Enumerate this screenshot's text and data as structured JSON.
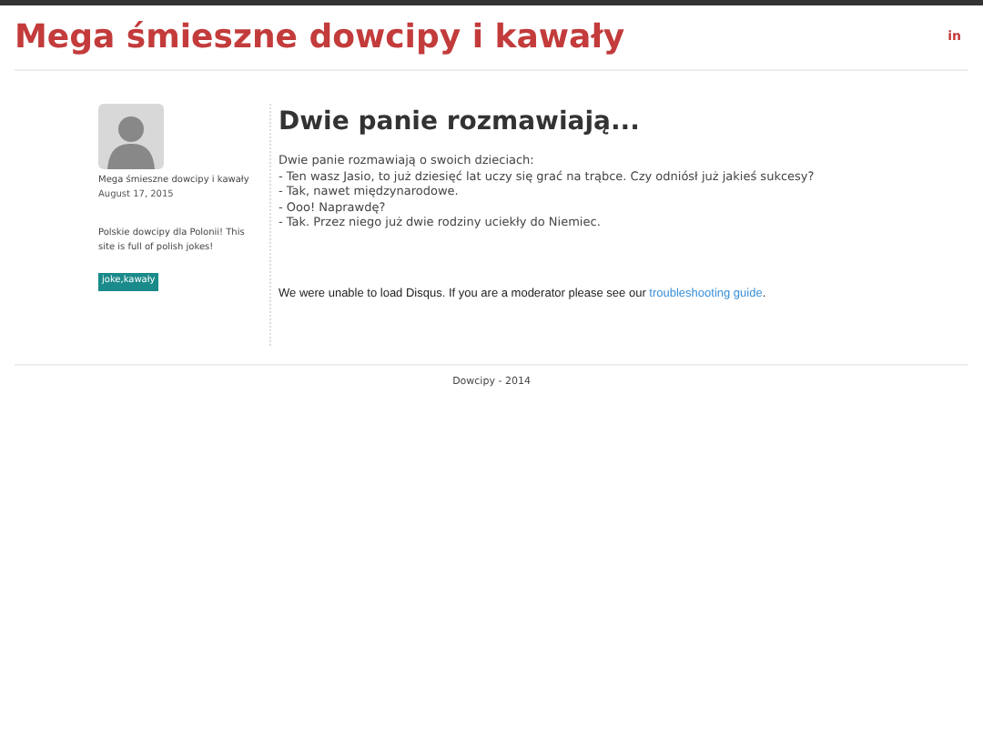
{
  "header": {
    "title": "Mega śmieszne dowcipy i kawały",
    "social": "in"
  },
  "sidebar": {
    "author": "Mega śmieszne dowcipy i kawały",
    "date": "August 17, 2015",
    "description": "Polskie dowcipy dla Polonii! This site is full of polish jokes!",
    "tags": [
      "joke,kawały"
    ]
  },
  "post": {
    "title": "Dwie panie rozmawiają...",
    "lines": [
      "Dwie panie rozmawiają o swoich dzieciach:",
      "- Ten wasz Jasio, to już dziesięć lat uczy się grać na trąbce. Czy odniósł już jakieś sukcesy?",
      "- Tak, nawet międzynarodowe.",
      "- Ooo! Naprawdę?",
      "- Tak. Przez niego już dwie rodziny uciekły do Niemiec."
    ]
  },
  "comments": {
    "message": "We were unable to load Disqus. If you are a moderator please see our",
    "link": "troubleshooting guide",
    "suffix": "."
  },
  "footer": {
    "text": "Dowcipy - 2014"
  }
}
